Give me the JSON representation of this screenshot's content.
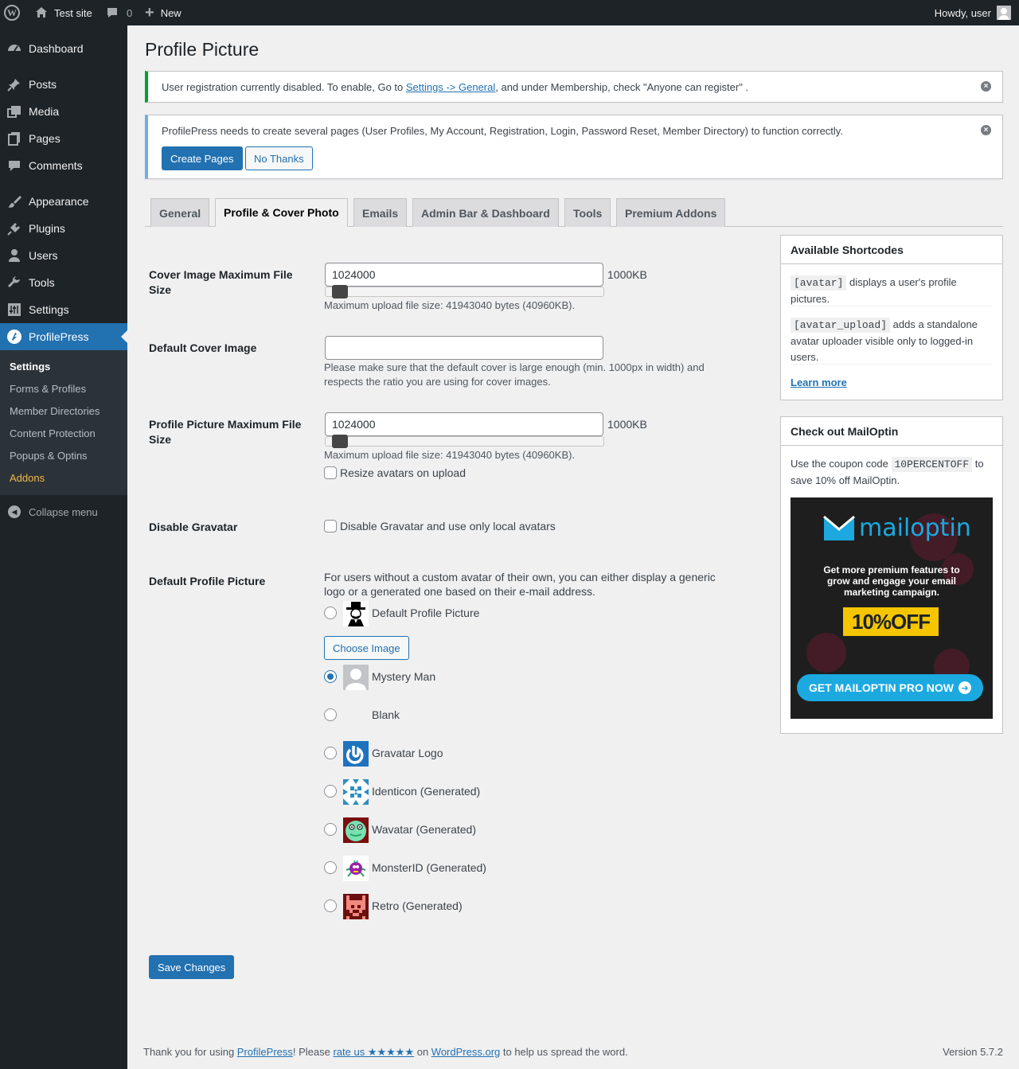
{
  "adminbar": {
    "site_name": "Test site",
    "comments_count": "0",
    "new_label": "New",
    "howdy": "Howdy, user"
  },
  "sidebar": {
    "items": [
      {
        "label": "Dashboard",
        "icon": "dashboard-icon"
      },
      {
        "label": "Posts",
        "icon": "pushpin-icon"
      },
      {
        "label": "Media",
        "icon": "media-icon"
      },
      {
        "label": "Pages",
        "icon": "pages-icon"
      },
      {
        "label": "Comments",
        "icon": "comment-icon"
      },
      {
        "label": "Appearance",
        "icon": "brush-icon"
      },
      {
        "label": "Plugins",
        "icon": "plug-icon"
      },
      {
        "label": "Users",
        "icon": "user-icon"
      },
      {
        "label": "Tools",
        "icon": "wrench-icon"
      },
      {
        "label": "Settings",
        "icon": "sliders-icon"
      },
      {
        "label": "ProfilePress",
        "icon": "profilepress-icon"
      }
    ],
    "submenu": [
      "Settings",
      "Forms & Profiles",
      "Member Directories",
      "Content Protection",
      "Popups & Optins",
      "Addons"
    ],
    "collapse": "Collapse menu"
  },
  "page": {
    "title": "Profile Picture"
  },
  "notice1": {
    "pre": "User registration currently disabled. To enable, Go to ",
    "link": "Settings -> General",
    "post": ", and under Membership, check \"Anyone can register\" ."
  },
  "notice2": {
    "text": "ProfilePress needs to create several pages (User Profiles, My Account, Registration, Login, Password Reset, Member Directory) to function correctly.",
    "create_btn": "Create Pages",
    "no_btn": "No Thanks"
  },
  "tabs": [
    "General",
    "Profile & Cover Photo",
    "Emails",
    "Admin Bar & Dashboard",
    "Tools",
    "Premium Addons"
  ],
  "form": {
    "cover_max": {
      "label": "Cover Image Maximum File Size",
      "value": "1024000",
      "unit": "1000KB",
      "desc": "Maximum upload file size: 41943040 bytes (40960KB).",
      "slider_fraction": 0.024
    },
    "default_cover": {
      "label": "Default Cover Image",
      "value": "",
      "desc": "Please make sure that the default cover is large enough (min. 1000px in width) and respects the ratio you are using for cover images."
    },
    "picture_max": {
      "label": "Profile Picture Maximum File Size",
      "value": "1024000",
      "unit": "1000KB",
      "desc": "Maximum upload file size: 41943040 bytes (40960KB).",
      "slider_fraction": 0.024,
      "resize_label": "Resize avatars on upload"
    },
    "gravatar": {
      "label": "Disable Gravatar",
      "checkbox_label": "Disable Gravatar and use only local avatars"
    },
    "default_picture": {
      "label": "Default Profile Picture",
      "intro": "For users without a custom avatar of their own, you can either display a generic logo or a generated one based on their e-mail address.",
      "choose_btn": "Choose Image",
      "options": [
        {
          "label": "Default Profile Picture",
          "checked": false
        },
        {
          "label": "Mystery Man",
          "checked": true
        },
        {
          "label": "Blank",
          "checked": false
        },
        {
          "label": "Gravatar Logo",
          "checked": false
        },
        {
          "label": "Identicon (Generated)",
          "checked": false
        },
        {
          "label": "Wavatar (Generated)",
          "checked": false
        },
        {
          "label": "MonsterID (Generated)",
          "checked": false
        },
        {
          "label": "Retro (Generated)",
          "checked": false
        }
      ]
    },
    "save_btn": "Save Changes"
  },
  "shortcodes": {
    "title": "Available Shortcodes",
    "items": [
      {
        "code": "[avatar]",
        "text": "displays a user's profile pictures."
      },
      {
        "code": "[avatar_upload]",
        "text": "adds a standalone avatar uploader visible only to logged-in users."
      }
    ],
    "learn_more": "Learn more"
  },
  "mailoptin": {
    "title": "Check out MailOptin",
    "pre": "Use the coupon code",
    "code": "10PERCENTOFF",
    "post": "to save 10% off MailOptin.",
    "banner": {
      "brand": "mailoptin",
      "headline": "Get more premium features to grow and engage your email marketing campaign.",
      "discount": "10%OFF",
      "cta": "GET MAILOPTIN PRO NOW"
    }
  },
  "footer": {
    "pre": "Thank you for using ",
    "link1": "ProfilePress",
    "mid1": "! Please ",
    "link2": "rate us ★★★★★",
    "mid2": " on ",
    "link3": "WordPress.org",
    "post": " to help us spread the word.",
    "version": "Version 5.7.2"
  }
}
